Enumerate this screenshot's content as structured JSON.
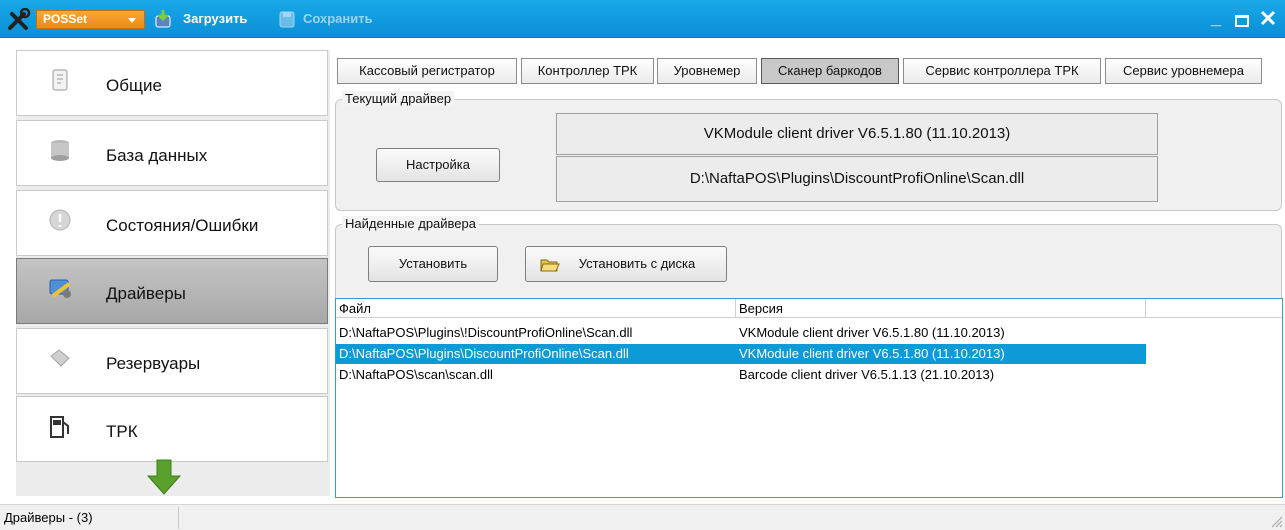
{
  "toolbar": {
    "app_menu_label": "POSSet",
    "load_label": "Загрузить",
    "save_label": "Сохранить",
    "minimize_glyph": "_"
  },
  "sidebar": {
    "items": [
      {
        "label": "Общие",
        "icon": "document-icon"
      },
      {
        "label": "База данных",
        "icon": "database-icon"
      },
      {
        "label": "Состояния/Ошибки",
        "icon": "error-state-icon"
      },
      {
        "label": "Драйверы",
        "icon": "drivers-icon",
        "active": true
      },
      {
        "label": "Резервуары",
        "icon": "tank-icon"
      },
      {
        "label": "ТРК",
        "icon": "fuel-pump-icon"
      }
    ]
  },
  "tabs": [
    "Кассовый регистратор",
    "Контроллер ТРК",
    "Уровнемер",
    "Сканер баркодов",
    "Сервис контроллера ТРК",
    "Сервис уровнемера"
  ],
  "current_driver": {
    "title": "Текущий драйвер",
    "settings_label": "Настройка",
    "name": "VKModule client driver V6.5.1.80 (11.10.2013)",
    "path": "D:\\NaftaPOS\\Plugins\\DiscountProfiOnline\\Scan.dll"
  },
  "found_drivers": {
    "title": "Найденные драйвера",
    "install_label": "Установить",
    "install_from_disk_label": "Установить с диска",
    "columns": [
      "Файл",
      "Версия"
    ],
    "rows": [
      {
        "file": "D:\\NaftaPOS\\Plugins\\!DiscountProfiOnline\\Scan.dll",
        "version": "VKModule client driver V6.5.1.80 (11.10.2013)"
      },
      {
        "file": "D:\\NaftaPOS\\Plugins\\DiscountProfiOnline\\Scan.dll",
        "version": "VKModule client driver V6.5.1.80 (11.10.2013)",
        "selected": true
      },
      {
        "file": "D:\\NaftaPOS\\scan\\scan.dll",
        "version": "Barcode client driver V6.5.1.13 (21.10.2013)"
      }
    ]
  },
  "status": {
    "text": "Драйверы - (3)"
  },
  "colors": {
    "titlebar": "#0a8fd6",
    "accent_orange": "#ee8a12",
    "selection": "#0e9ad7"
  }
}
